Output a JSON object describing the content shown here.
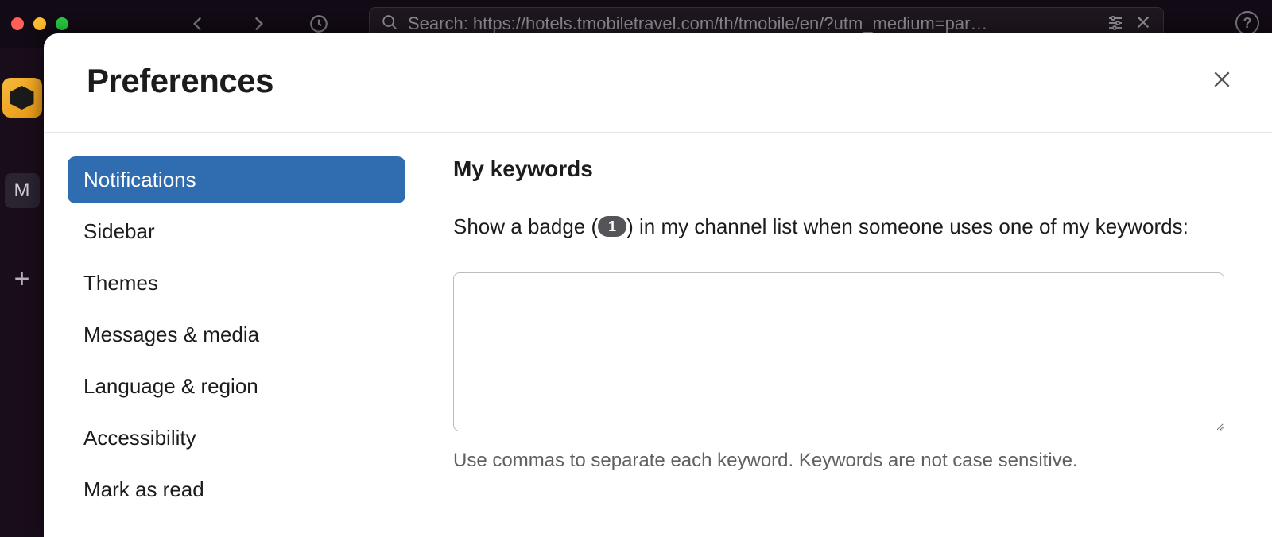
{
  "titlebar": {
    "search_text": "Search: https://hotels.tmobiletravel.com/th/tmobile/en/?utm_medium=par…"
  },
  "workspace": {
    "letter": "M"
  },
  "modal": {
    "title": "Preferences"
  },
  "sidebar": {
    "items": [
      {
        "label": "Notifications",
        "active": true
      },
      {
        "label": "Sidebar",
        "active": false
      },
      {
        "label": "Themes",
        "active": false
      },
      {
        "label": "Messages & media",
        "active": false
      },
      {
        "label": "Language & region",
        "active": false
      },
      {
        "label": "Accessibility",
        "active": false
      },
      {
        "label": "Mark as read",
        "active": false
      }
    ]
  },
  "content": {
    "heading": "My keywords",
    "desc_before": "Show a badge (",
    "badge_count": "1",
    "desc_after": ") in my channel list when someone uses one of my keywords:",
    "textarea_value": "",
    "helper": "Use commas to separate each keyword. Keywords are not case sensitive."
  }
}
